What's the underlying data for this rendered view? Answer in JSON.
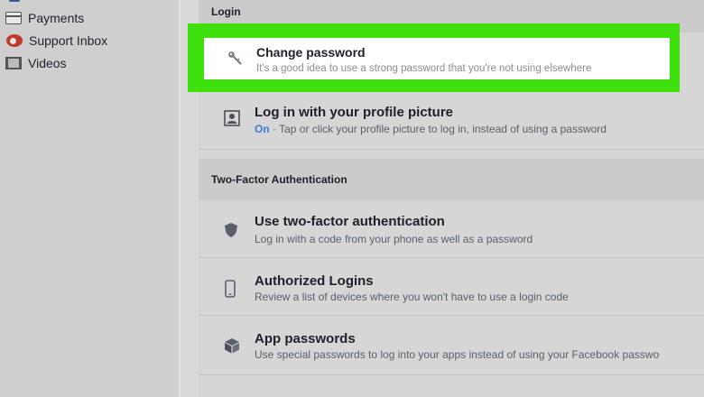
{
  "sidebar": {
    "items": [
      {
        "label": "Payments",
        "icon": "payments-icon"
      },
      {
        "label": "Support Inbox",
        "icon": "support-inbox-icon"
      },
      {
        "label": "Videos",
        "icon": "videos-icon"
      }
    ]
  },
  "login": {
    "header": "Login",
    "change_password": {
      "title": "Change password",
      "desc": "It's a good idea to use a strong password that you're not using elsewhere"
    },
    "profile_picture": {
      "title": "Log in with your profile picture",
      "status": "On",
      "desc": " · Tap or click your profile picture to log in, instead of using a password"
    }
  },
  "two_factor": {
    "header": "Two-Factor Authentication",
    "items": [
      {
        "title": "Use two-factor authentication",
        "desc": "Log in with a code from your phone as well as a password",
        "icon": "shield-icon"
      },
      {
        "title": "Authorized Logins",
        "desc": "Review a list of devices where you won't have to use a login code",
        "icon": "phone-icon"
      },
      {
        "title": "App passwords",
        "desc": "Use special passwords to log into your apps instead of using your Facebook passwo",
        "icon": "cube-icon"
      }
    ]
  },
  "colors": {
    "highlight": "#3ee00e",
    "accent": "#3b78d8"
  }
}
